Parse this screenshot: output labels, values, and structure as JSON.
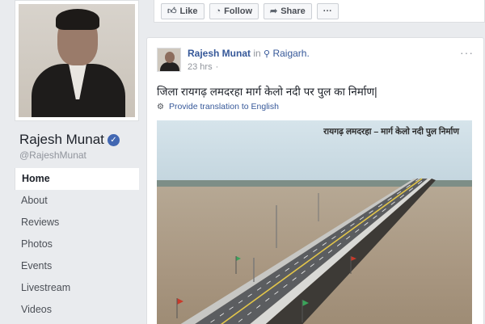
{
  "profile": {
    "name": "Rajesh Munat",
    "handle": "@RajeshMunat"
  },
  "nav": {
    "items": [
      {
        "label": "Home",
        "active": true
      },
      {
        "label": "About"
      },
      {
        "label": "Reviews"
      },
      {
        "label": "Photos"
      },
      {
        "label": "Events"
      },
      {
        "label": "Livestream"
      },
      {
        "label": "Videos"
      }
    ]
  },
  "actions": {
    "like": "Like",
    "follow": "Follow",
    "share": "Share",
    "more": "···"
  },
  "post": {
    "author": "Rajesh Munat",
    "in_word": "in",
    "place": "Raigarh.",
    "time": "23 hrs",
    "text": "जिला रायगढ़ लमदरहा मार्ग केलो नदी पर पुल का निर्माण|",
    "translate_link": "Provide translation to English",
    "image_caption": "रायगढ़ लमदरहा – मार्ग केलो नदी पुल निर्माण",
    "menu": "···"
  },
  "icons": {
    "verified": "verified-badge-icon",
    "like": "thumbs-up-icon",
    "follow": "rss-icon",
    "share": "share-arrow-icon",
    "location": "map-pin-icon",
    "privacy": "globe-icon",
    "translate": "gear-icon"
  },
  "colors": {
    "link": "#365899",
    "verified": "#4267b2",
    "background": "#e9ebee"
  }
}
